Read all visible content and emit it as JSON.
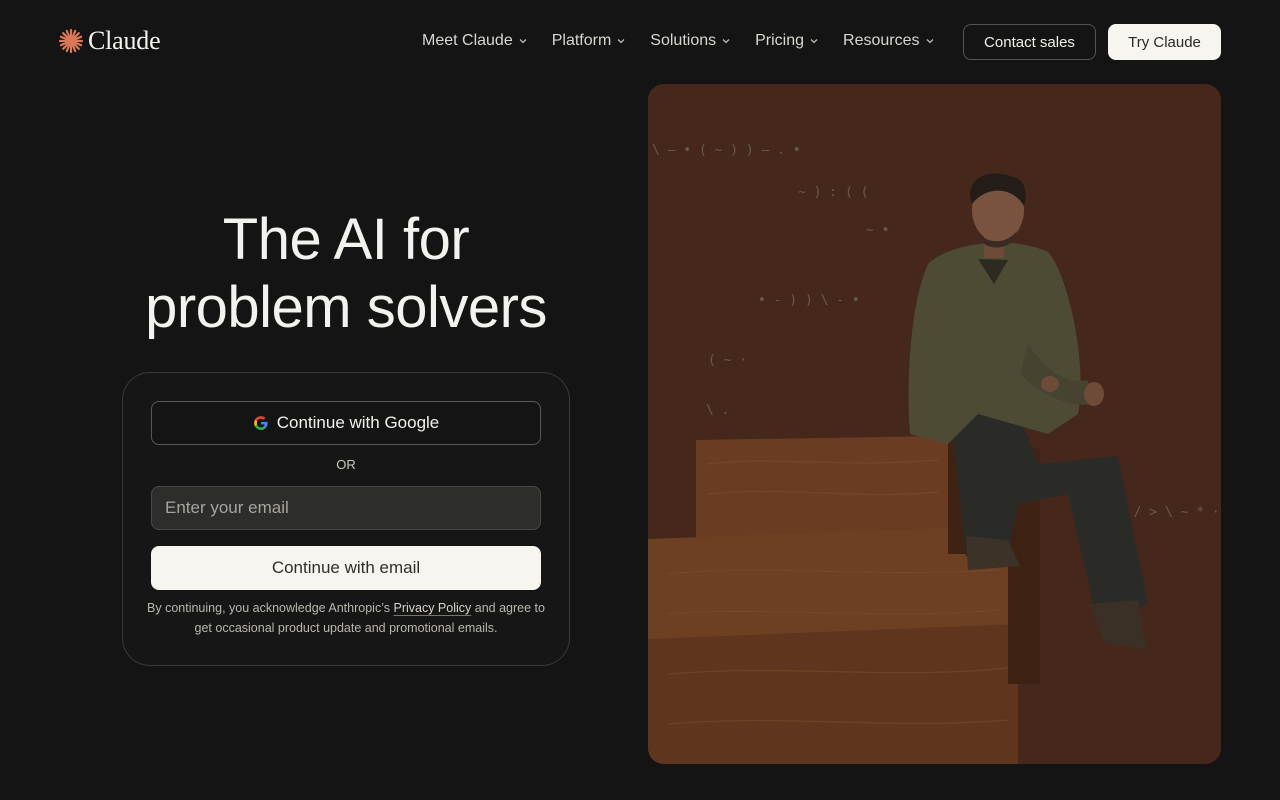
{
  "brand": {
    "name": "Claude",
    "logo_icon": "claude-starburst-icon",
    "accent_color": "#d97757"
  },
  "nav": {
    "items": [
      {
        "label": "Meet Claude",
        "icon": "chevron-down-icon"
      },
      {
        "label": "Platform",
        "icon": "chevron-down-icon"
      },
      {
        "label": "Solutions",
        "icon": "chevron-down-icon"
      },
      {
        "label": "Pricing",
        "icon": "chevron-down-icon"
      },
      {
        "label": "Resources",
        "icon": "chevron-down-icon"
      }
    ],
    "contact_sales_label": "Contact sales",
    "try_claude_label": "Try Claude"
  },
  "hero": {
    "title_line1": "The AI for",
    "title_line2": "problem solvers"
  },
  "login": {
    "google_button_label": "Continue with Google",
    "google_icon": "google-g-icon",
    "or_label": "OR",
    "email_placeholder": "Enter your email",
    "email_value": "",
    "email_button_label": "Continue with email",
    "legal_prefix": "By continuing, you acknowledge Anthropic’s",
    "legal_link": "Privacy Policy",
    "legal_suffix": "and agree to get occasional product update and promotional emails."
  },
  "colors": {
    "background": "#141414",
    "hero_image_background": "#46271c",
    "primary_button": "#f7f5f0"
  }
}
